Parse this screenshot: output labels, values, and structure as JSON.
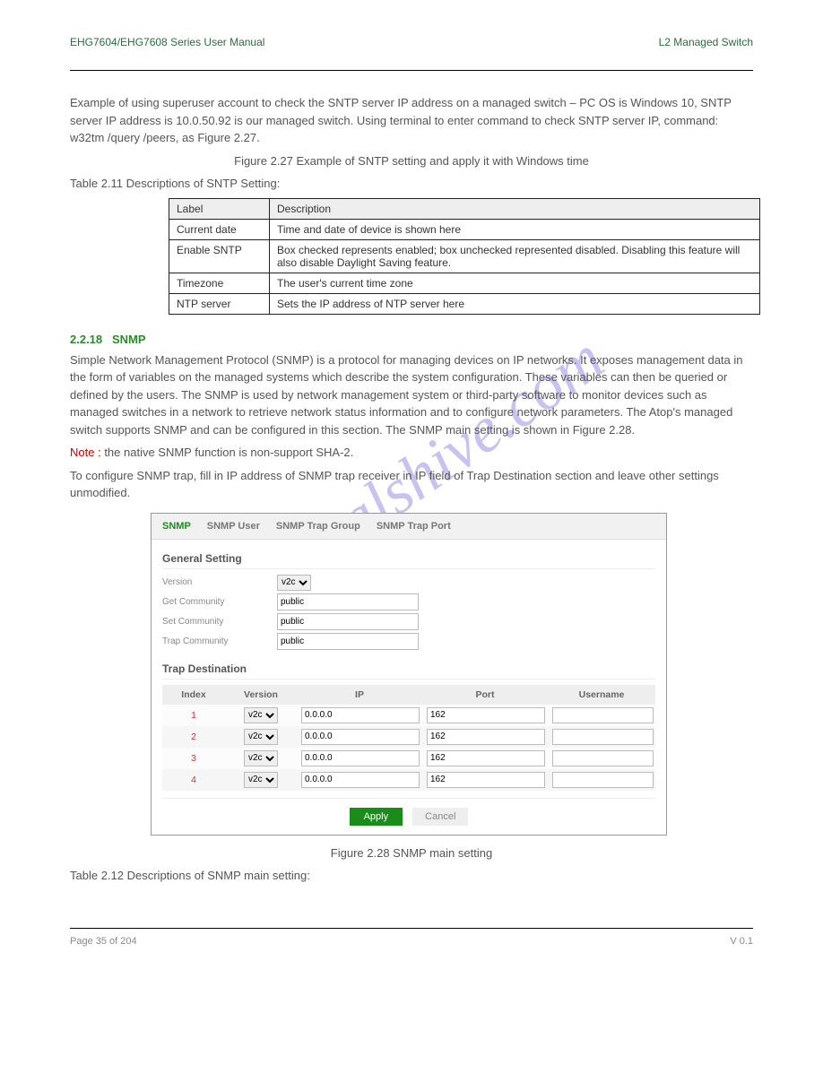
{
  "header": {
    "left": "EHG7604/EHG7608 Series User Manual",
    "right": "L2 Managed Switch"
  },
  "footer": {
    "left": "Page 35 of 204",
    "right": "V 0.1"
  },
  "watermark": "manualshive.com",
  "body": {
    "intro1": "Example of using superuser account to check the SNTP server IP address on a managed switch – PC OS is Windows 10, SNTP server IP address is 10.0.50.92 is our managed switch. Using terminal to enter command to check SNTP server IP, command: w32tm /query /peers, as Figure 2.27.",
    "fig227": "Figure 2.27 Example of SNTP setting and apply it with Windows time",
    "tbl211_caption": "Table 2.11 Descriptions of SNTP Setting:",
    "tbl211": {
      "head": {
        "c1": "Label",
        "c2": "Description"
      },
      "rows": [
        {
          "c1": "Current date",
          "c2": "Time and date of device is shown here"
        },
        {
          "c1": "Enable SNTP",
          "c2": "Box checked represents enabled; box unchecked represented disabled. Disabling this feature will also disable Daylight Saving feature."
        },
        {
          "c1": "Timezone",
          "c2": "The user's current time zone"
        },
        {
          "c1": "NTP server",
          "c2": "Sets the IP address of NTP server here"
        }
      ]
    },
    "section_2218_num": "2.2.18",
    "section_2218_title": "SNMP",
    "p2218a": "Simple Network Management Protocol (SNMP) is a protocol for managing devices on IP networks. It exposes management data in the form of variables on the managed systems which describe the system configuration. These variables can then be queried or defined by the users. The SNMP is used by network management system or third-party software to monitor devices such as managed switches in a network to retrieve network status information and to configure network parameters. The Atop's managed switch supports SNMP and can be configured in this section. The SNMP main setting is shown in Figure 2.28.",
    "note_label": "Note :",
    "note_text": "the native SNMP function is non-support SHA-2.",
    "p2218b": "To configure SNMP trap, fill in IP address of SNMP trap receiver in IP field of Trap Destination section and leave other settings unmodified.",
    "fig228": "Figure 2.28 SNMP main setting",
    "tbl212_caption": "Table 2.12 Descriptions of SNMP main setting:"
  },
  "ui": {
    "tabs": [
      "SNMP",
      "SNMP User",
      "SNMP Trap Group",
      "SNMP Trap Port"
    ],
    "general_title": "General Setting",
    "fields": {
      "version_label": "Version",
      "version_value": "v2c",
      "get_label": "Get Community",
      "get_value": "public",
      "set_label": "Set Community",
      "set_value": "public",
      "trap_label": "Trap Community",
      "trap_value": "public"
    },
    "trap_title": "Trap Destination",
    "trap_head": {
      "c1": "Index",
      "c2": "Version",
      "c3": "IP",
      "c4": "Port",
      "c5": "Username"
    },
    "trap_rows": [
      {
        "idx": "1",
        "ver": "v2c",
        "ip": "0.0.0.0",
        "port": "162",
        "user": ""
      },
      {
        "idx": "2",
        "ver": "v2c",
        "ip": "0.0.0.0",
        "port": "162",
        "user": ""
      },
      {
        "idx": "3",
        "ver": "v2c",
        "ip": "0.0.0.0",
        "port": "162",
        "user": ""
      },
      {
        "idx": "4",
        "ver": "v2c",
        "ip": "0.0.0.0",
        "port": "162",
        "user": ""
      }
    ],
    "apply": "Apply",
    "cancel": "Cancel"
  }
}
